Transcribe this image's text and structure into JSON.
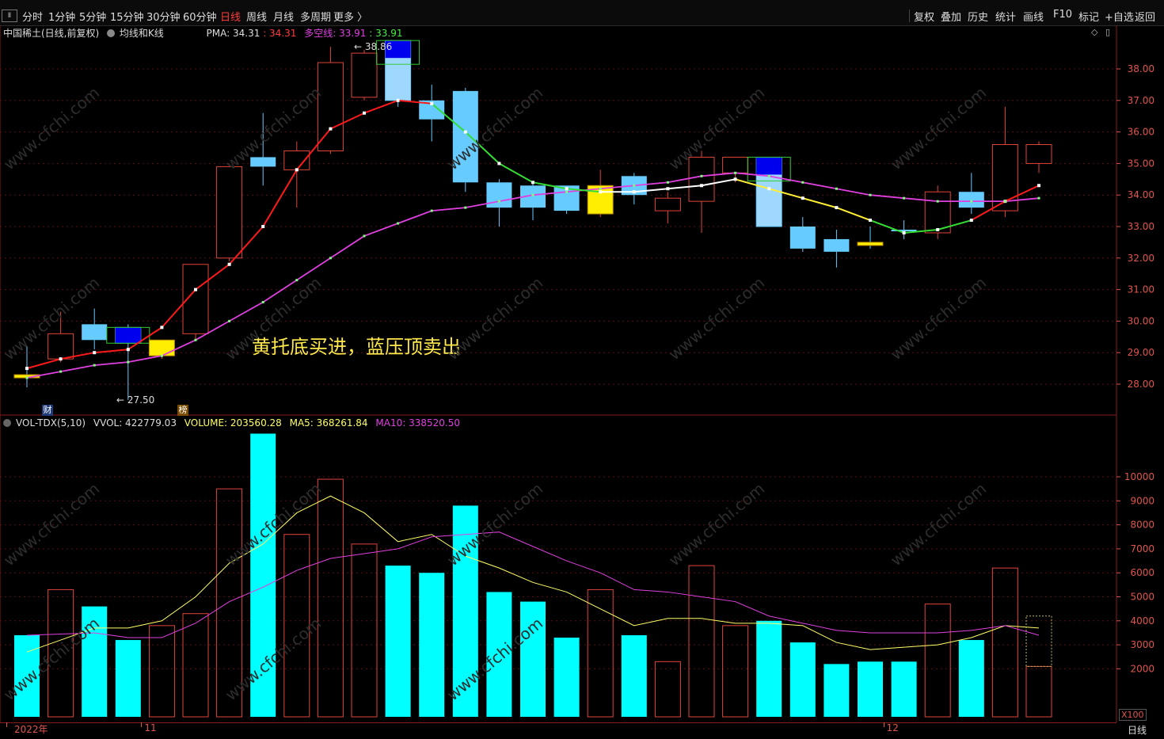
{
  "toolbar": {
    "app_icon": "Ⅱ",
    "timeframes": [
      {
        "label": "分时",
        "active": false
      },
      {
        "label": "1分钟",
        "active": false
      },
      {
        "label": "5分钟",
        "active": false
      },
      {
        "label": "15分钟",
        "active": false
      },
      {
        "label": "30分钟",
        "active": false
      },
      {
        "label": "60分钟",
        "active": false
      },
      {
        "label": "日线",
        "active": true
      },
      {
        "label": "周线",
        "active": false
      },
      {
        "label": "月线",
        "active": false
      },
      {
        "label": "多周期",
        "active": false
      },
      {
        "label": "更多 〉",
        "active": false
      }
    ],
    "buttons": [
      "复权",
      "叠加",
      "历史",
      "统计",
      "画线",
      "F10",
      "标记",
      "+自选",
      "返回"
    ]
  },
  "kline_info": {
    "stock": "中国稀土(日线,前复权)",
    "indicator": "均线和K线",
    "pma_label": "PMA: 34.31",
    "pma_val": ": 34.31",
    "dkx_label": "多空线: 33.91",
    "dkx_val": ": 33.91"
  },
  "annotation": "黄托底买进，蓝压顶卖出",
  "marks": {
    "high": "38.86",
    "low": "27.50",
    "fin_badge": "财",
    "rank_badge": "榜"
  },
  "vol_info": {
    "name": "VOL-TDX(5,10)",
    "vvol": "VVOL: 422779.03",
    "volume": "VOLUME: 203560.28",
    "ma5": "MA5: 368261.84",
    "ma10": "MA10: 338520.50"
  },
  "vol_unit": "X100",
  "period_label": "日线",
  "x_labels": [
    {
      "label": "2022年",
      "i": 0
    },
    {
      "label": "11",
      "i": 4
    },
    {
      "label": "12",
      "i": 26
    }
  ],
  "watermark": "www.cfchi.com",
  "colors": {
    "up": "#e0443a",
    "down": "#66ccff",
    "pma": "#ff1a1a",
    "dkx": "#e040e0",
    "vol_down": "#00ffff",
    "grid": "#5a0f0f",
    "axis": "#e0554e",
    "ma5": "#ffff66",
    "ma10": "#e040e0",
    "yellow_mark": "#ffee00",
    "blue_mark": "#0000ee"
  },
  "chart_data": {
    "type": "candlestick",
    "price_ticks": [
      28.0,
      29.0,
      30.0,
      31.0,
      32.0,
      33.0,
      34.0,
      35.0,
      36.0,
      37.0,
      38.0
    ],
    "vol_ticks": [
      2000,
      3000,
      4000,
      5000,
      6000,
      7000,
      8000,
      9000,
      10000
    ],
    "candles": [
      {
        "o": 28.3,
        "h": 29.2,
        "l": 27.9,
        "c": 28.2,
        "vol": 3400,
        "mark": "yellow"
      },
      {
        "o": 28.8,
        "h": 30.3,
        "l": 28.7,
        "c": 29.6,
        "vol": 5300
      },
      {
        "o": 29.4,
        "h": 30.4,
        "l": 29.1,
        "c": 29.9,
        "vol": 4600,
        "dir": "down"
      },
      {
        "o": 29.8,
        "h": 29.9,
        "l": 27.5,
        "c": 29.3,
        "vol": 3200,
        "mark": "blue"
      },
      {
        "o": 28.9,
        "h": 29.4,
        "l": 28.8,
        "c": 29.4,
        "vol": 3800,
        "mark": "yellow"
      },
      {
        "o": 29.6,
        "h": 31.8,
        "l": 29.4,
        "c": 31.8,
        "vol": 4300
      },
      {
        "o": 32.0,
        "h": 34.9,
        "l": 31.9,
        "c": 34.9,
        "vol": 9500
      },
      {
        "o": 35.2,
        "h": 36.6,
        "l": 34.3,
        "c": 34.9,
        "vol": 11800,
        "dir": "down"
      },
      {
        "o": 34.8,
        "h": 35.7,
        "l": 33.6,
        "c": 35.4,
        "vol": 7600
      },
      {
        "o": 35.4,
        "h": 38.7,
        "l": 35.3,
        "c": 38.2,
        "vol": 9900
      },
      {
        "o": 37.1,
        "h": 38.6,
        "l": 37.0,
        "c": 38.5,
        "vol": 7200
      },
      {
        "o": 38.9,
        "h": 38.9,
        "l": 36.8,
        "c": 37.0,
        "vol": 6300,
        "mark": "blue"
      },
      {
        "o": 37.0,
        "h": 37.5,
        "l": 35.7,
        "c": 36.4,
        "vol": 6000
      },
      {
        "o": 37.3,
        "h": 37.4,
        "l": 34.1,
        "c": 34.4,
        "vol": 8800,
        "dir": "down"
      },
      {
        "o": 34.4,
        "h": 34.5,
        "l": 33.0,
        "c": 33.6,
        "vol": 5200,
        "dir": "down"
      },
      {
        "o": 34.3,
        "h": 34.4,
        "l": 33.2,
        "c": 33.6,
        "vol": 4800
      },
      {
        "o": 34.3,
        "h": 34.3,
        "l": 33.4,
        "c": 33.5,
        "vol": 3300,
        "dir": "down"
      },
      {
        "o": 33.4,
        "h": 34.8,
        "l": 33.3,
        "c": 34.3,
        "vol": 5300,
        "mark": "yellow"
      },
      {
        "o": 34.0,
        "h": 34.7,
        "l": 33.7,
        "c": 34.6,
        "vol": 3400,
        "dir": "down"
      },
      {
        "o": 33.5,
        "h": 34.1,
        "l": 33.1,
        "c": 33.9,
        "vol": 2300
      },
      {
        "o": 33.8,
        "h": 35.4,
        "l": 32.8,
        "c": 35.2,
        "vol": 6300
      },
      {
        "o": 34.7,
        "h": 35.2,
        "l": 34.4,
        "c": 35.2,
        "vol": 3800
      },
      {
        "o": 35.2,
        "h": 35.2,
        "l": 33.0,
        "c": 33.0,
        "vol": 4000,
        "mark": "blue"
      },
      {
        "o": 33.0,
        "h": 33.3,
        "l": 32.2,
        "c": 32.3,
        "vol": 3100,
        "dir": "down"
      },
      {
        "o": 32.6,
        "h": 32.9,
        "l": 31.7,
        "c": 32.2,
        "vol": 2200
      },
      {
        "o": 32.5,
        "h": 33.0,
        "l": 32.3,
        "c": 32.4,
        "vol": 2300,
        "mark": "yellow"
      },
      {
        "o": 32.9,
        "h": 33.2,
        "l": 32.6,
        "c": 32.9,
        "vol": 2300,
        "dir": "down"
      },
      {
        "o": 32.8,
        "h": 34.3,
        "l": 32.6,
        "c": 34.1,
        "vol": 4700
      },
      {
        "o": 33.6,
        "h": 34.7,
        "l": 33.4,
        "c": 34.1,
        "vol": 3200,
        "dir": "down"
      },
      {
        "o": 33.5,
        "h": 36.8,
        "l": 33.3,
        "c": 35.6,
        "vol": 6200
      },
      {
        "o": 35.0,
        "h": 35.7,
        "l": 34.7,
        "c": 35.6,
        "vol": 2100
      }
    ],
    "pma": [
      28.5,
      28.8,
      29.0,
      29.1,
      29.8,
      31.0,
      31.8,
      33.0,
      34.8,
      36.1,
      36.6,
      37.0,
      36.9,
      36.0,
      35.0,
      34.4,
      34.2,
      34.1,
      34.1,
      34.2,
      34.3,
      34.5,
      34.2,
      33.9,
      33.6,
      33.2,
      32.8,
      32.9,
      33.2,
      33.8,
      34.3
    ],
    "dkx": [
      28.2,
      28.4,
      28.6,
      28.7,
      28.9,
      29.4,
      30.0,
      30.6,
      31.3,
      32.0,
      32.7,
      33.1,
      33.5,
      33.6,
      33.8,
      34.0,
      34.1,
      34.2,
      34.3,
      34.4,
      34.6,
      34.7,
      34.6,
      34.4,
      34.2,
      34.0,
      33.9,
      33.8,
      33.8,
      33.8,
      33.9
    ],
    "ma5_vol": [
      2700,
      3200,
      3700,
      3700,
      4000,
      5000,
      6400,
      7200,
      8500,
      9200,
      8500,
      7300,
      7600,
      6700,
      6200,
      5600,
      5200,
      4500,
      3800,
      4100,
      4100,
      3900,
      3900,
      3800,
      3100,
      2800,
      2900,
      3000,
      3300,
      3800,
      3700
    ],
    "ma10_vol": [
      3400,
      3450,
      3500,
      3300,
      3300,
      3900,
      4800,
      5400,
      6100,
      6600,
      6800,
      7000,
      7500,
      7600,
      7700,
      7100,
      6500,
      6000,
      5300,
      5200,
      5000,
      4800,
      4200,
      3900,
      3600,
      3500,
      3500,
      3500,
      3600,
      3800,
      3400
    ]
  }
}
